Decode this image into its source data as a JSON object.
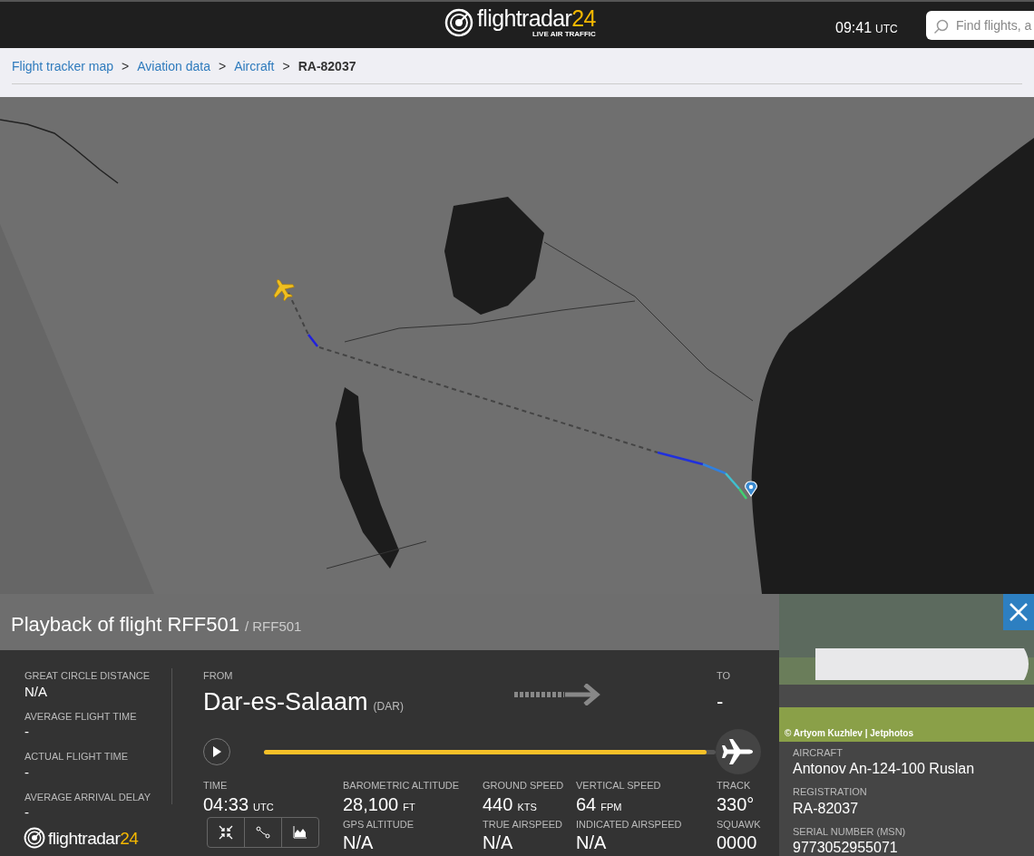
{
  "header": {
    "logo": {
      "name": "flightradar",
      "suffix": "24",
      "tagline": "LIVE AIR TRAFFIC"
    },
    "clock": {
      "time": "09:41",
      "zone": "UTC"
    },
    "search": {
      "placeholder": "Find flights, a"
    }
  },
  "breadcrumbs": [
    {
      "label": "Flight tracker map",
      "current": false
    },
    {
      "label": "Aviation data",
      "current": false
    },
    {
      "label": "Aircraft",
      "current": false
    },
    {
      "label": "RA-82037",
      "current": true
    }
  ],
  "breadcrumb_separator": ">",
  "playback": {
    "title": "Playback of flight RFF501",
    "callsign": "/ RFF501"
  },
  "stats": [
    {
      "label": "GREAT CIRCLE DISTANCE",
      "value": "N/A"
    },
    {
      "label": "AVERAGE FLIGHT TIME",
      "value": "-"
    },
    {
      "label": "ACTUAL FLIGHT TIME",
      "value": "-"
    },
    {
      "label": "AVERAGE ARRIVAL DELAY",
      "value": "-"
    }
  ],
  "route": {
    "from_label": "FROM",
    "from_city": "Dar-es-Salaam",
    "from_code": "(DAR)",
    "to_label": "TO",
    "to_value": "-"
  },
  "progress": {
    "level": 0.98
  },
  "telemetry": [
    {
      "label": "TIME",
      "value": "04:33",
      "unit": "UTC"
    },
    {
      "label": "BAROMETRIC ALTITUDE",
      "value": "28,100",
      "unit": "FT"
    },
    {
      "label": "GROUND SPEED",
      "value": "440",
      "unit": "KTS"
    },
    {
      "label": "VERTICAL SPEED",
      "value": "64",
      "unit": "FPM"
    },
    {
      "label": "TRACK",
      "value": "330°"
    },
    {
      "label": "GPS ALTITUDE",
      "value": "N/A"
    },
    {
      "label": "TRUE AIRSPEED",
      "value": "N/A"
    },
    {
      "label": "INDICATED AIRSPEED",
      "value": "N/A"
    },
    {
      "label": "SQUAWK",
      "value": "0000"
    }
  ],
  "footer_logo": {
    "name": "flightradar",
    "suffix": "24"
  },
  "aircraft": {
    "photo_credit": "© Artyom Kuzhlev | Jetphotos",
    "fields": [
      {
        "label": "AIRCRAFT",
        "value": "Antonov An-124-100 Ruslan"
      },
      {
        "label": "REGISTRATION",
        "value": "RA-82037"
      },
      {
        "label": "SERIAL NUMBER (MSN)",
        "value": "9773052955071"
      }
    ]
  }
}
